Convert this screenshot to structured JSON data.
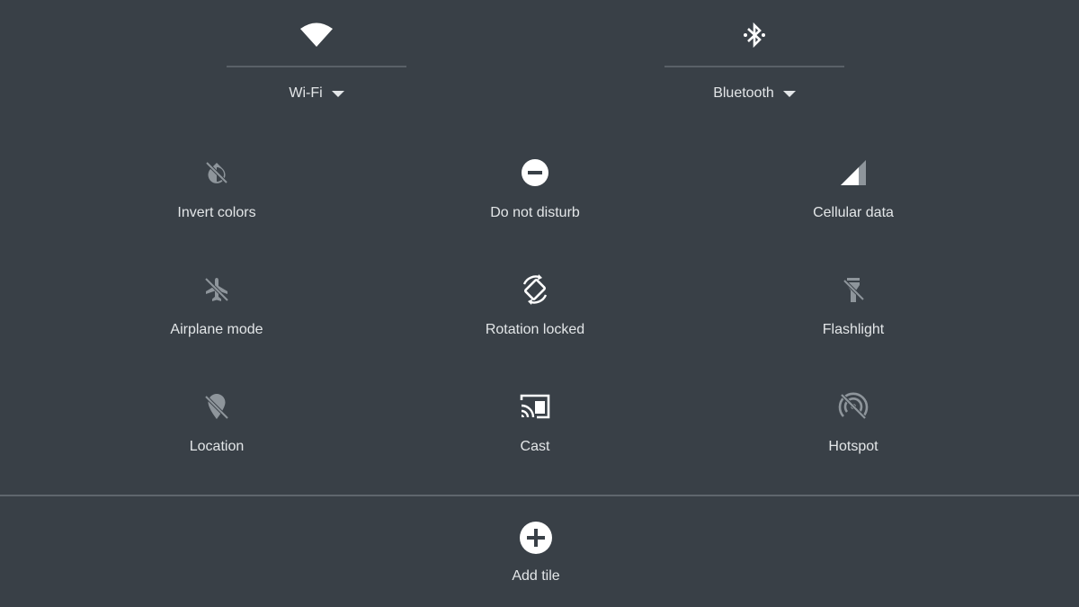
{
  "colors": {
    "background": "#394047",
    "text": "#e3e6e8",
    "icon_active": "#ffffff",
    "icon_inactive": "#8e959b",
    "divider": "#5f666d"
  },
  "top_tiles": {
    "wifi": {
      "label": "Wi-Fi",
      "icon": "wifi-icon",
      "state": "on"
    },
    "bluetooth": {
      "label": "Bluetooth",
      "icon": "bluetooth-icon",
      "state": "on"
    }
  },
  "tiles": [
    {
      "label": "Invert colors",
      "icon": "invert-colors-off-icon",
      "state": "off"
    },
    {
      "label": "Do not disturb",
      "icon": "do-not-disturb-icon",
      "state": "on"
    },
    {
      "label": "Cellular data",
      "icon": "cellular-signal-icon",
      "state": "on"
    },
    {
      "label": "Airplane mode",
      "icon": "airplane-off-icon",
      "state": "off"
    },
    {
      "label": "Rotation locked",
      "icon": "screen-rotation-icon",
      "state": "on"
    },
    {
      "label": "Flashlight",
      "icon": "flashlight-off-icon",
      "state": "off"
    },
    {
      "label": "Location",
      "icon": "location-off-icon",
      "state": "off"
    },
    {
      "label": "Cast",
      "icon": "cast-icon",
      "state": "on"
    },
    {
      "label": "Hotspot",
      "icon": "hotspot-off-icon",
      "state": "off"
    }
  ],
  "add_tile": {
    "label": "Add tile",
    "icon": "add-circle-icon"
  }
}
